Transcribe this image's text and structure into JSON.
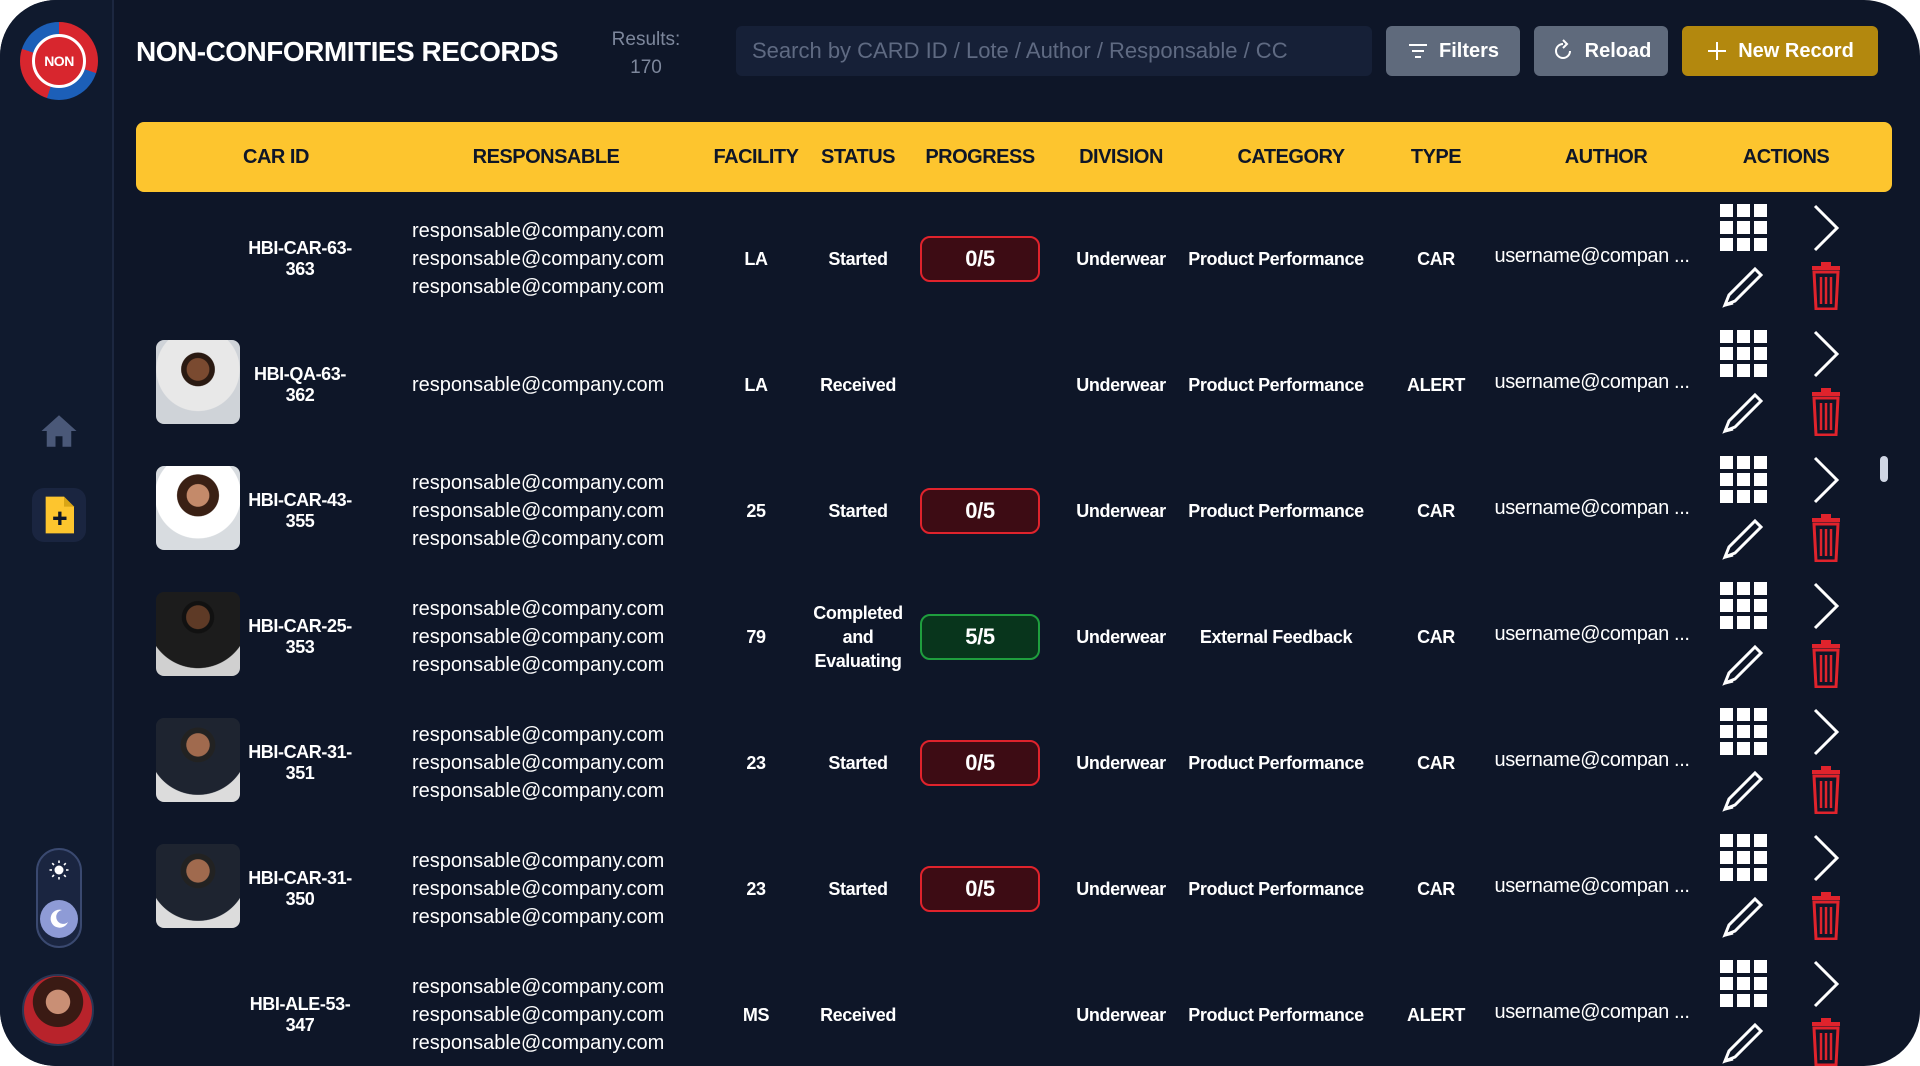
{
  "header": {
    "title": "NON-CONFORMITIES RECORDS",
    "results_label": "Results:",
    "results_count": "170",
    "search_placeholder": "Search by CARD ID / Lote / Author / Responsable / CC",
    "filters_label": "Filters",
    "reload_label": "Reload",
    "new_record_label": "New Record"
  },
  "logo": {
    "text": "NON"
  },
  "columns": [
    "CAR ID",
    "RESPONSABLE",
    "FACILITY",
    "STATUS",
    "PROGRESS",
    "DIVISION",
    "CATEGORY",
    "TYPE",
    "AUTHOR",
    "ACTIONS"
  ],
  "rows": [
    {
      "id": "HBI-CAR-63-363",
      "photo": false,
      "responsables": [
        "responsable@company.com",
        "responsable@company.com",
        "responsable@company.com"
      ],
      "facility": "LA",
      "status": "Started",
      "progress": "0/5",
      "progress_state": "red",
      "division": "Underwear",
      "category": "Product Performance",
      "type": "CAR",
      "author": "username@compan ..."
    },
    {
      "id": "HBI-QA-63-362",
      "photo": true,
      "responsables": [
        "responsable@company.com"
      ],
      "facility": "LA",
      "status": "Received",
      "progress": "",
      "progress_state": "none",
      "division": "Underwear",
      "category": "Product Performance",
      "type": "ALERT",
      "author": "username@compan ..."
    },
    {
      "id": "HBI-CAR-43-355",
      "photo": true,
      "responsables": [
        "responsable@company.com",
        "responsable@company.com",
        "responsable@company.com"
      ],
      "facility": "25",
      "status": "Started",
      "progress": "0/5",
      "progress_state": "red",
      "division": "Underwear",
      "category": "Product Performance",
      "type": "CAR",
      "author": "username@compan ..."
    },
    {
      "id": "HBI-CAR-25-353",
      "photo": true,
      "responsables": [
        "responsable@company.com",
        "responsable@company.com",
        "responsable@company.com"
      ],
      "facility": "79",
      "status": "Completed and Evaluating",
      "progress": "5/5",
      "progress_state": "green",
      "division": "Underwear",
      "category": "External Feedback",
      "type": "CAR",
      "author": "username@compan ..."
    },
    {
      "id": "HBI-CAR-31-351",
      "photo": true,
      "responsables": [
        "responsable@company.com",
        "responsable@company.com",
        "responsable@company.com"
      ],
      "facility": "23",
      "status": "Started",
      "progress": "0/5",
      "progress_state": "red",
      "division": "Underwear",
      "category": "Product Performance",
      "type": "CAR",
      "author": "username@compan ..."
    },
    {
      "id": "HBI-CAR-31-350",
      "photo": true,
      "responsables": [
        "responsable@company.com",
        "responsable@company.com",
        "responsable@company.com"
      ],
      "facility": "23",
      "status": "Started",
      "progress": "0/5",
      "progress_state": "red",
      "division": "Underwear",
      "category": "Product Performance",
      "type": "CAR",
      "author": "username@compan ..."
    },
    {
      "id": "HBI-ALE-53-347",
      "photo": false,
      "responsables": [
        "responsable@company.com",
        "responsable@company.com",
        "responsable@company.com"
      ],
      "facility": "MS",
      "status": "Received",
      "progress": "",
      "progress_state": "none",
      "division": "Underwear",
      "category": "Product Performance",
      "type": "ALERT",
      "author": "username@compan ..."
    }
  ],
  "colors": {
    "accent": "#fdc52e",
    "background": "#0e1628",
    "progress_red": "#e0232c",
    "progress_green": "#1f9e3e",
    "new_record": "#b3880e"
  },
  "icons": [
    "home-icon",
    "file-add-icon",
    "sun-icon",
    "moon-icon",
    "filter-icon",
    "reload-icon",
    "plus-icon",
    "grid-icon",
    "chevron-right-icon",
    "pencil-icon",
    "trash-icon"
  ]
}
